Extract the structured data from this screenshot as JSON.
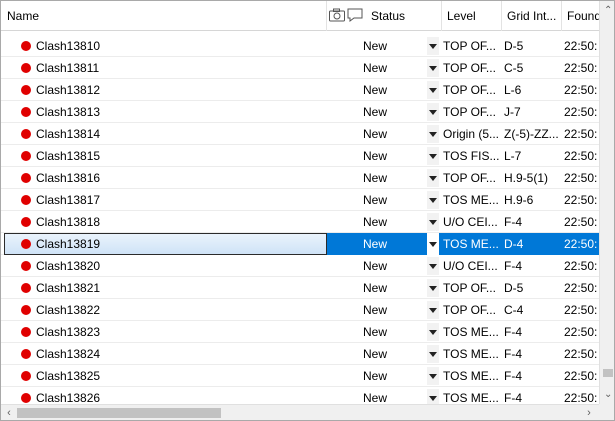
{
  "header": {
    "name": "Name",
    "status": "Status",
    "level": "Level",
    "grid": "Grid Int...",
    "found": "Found"
  },
  "icons": {
    "camera": "camera-icon",
    "comment": "comment-icon"
  },
  "colors": {
    "status_dot": "#e00000",
    "selection": "#0078d7"
  },
  "rows": [
    {
      "name": "Clash13810",
      "status": "New",
      "level": "TOP OF...",
      "grid": "D-5",
      "found": "22:50:"
    },
    {
      "name": "Clash13811",
      "status": "New",
      "level": "TOP OF...",
      "grid": "C-5",
      "found": "22:50:"
    },
    {
      "name": "Clash13812",
      "status": "New",
      "level": "TOP OF...",
      "grid": "L-6",
      "found": "22:50:"
    },
    {
      "name": "Clash13813",
      "status": "New",
      "level": "TOP OF...",
      "grid": "J-7",
      "found": "22:50:"
    },
    {
      "name": "Clash13814",
      "status": "New",
      "level": "Origin (5...",
      "grid": "Z(-5)-ZZ...",
      "found": "22:50:"
    },
    {
      "name": "Clash13815",
      "status": "New",
      "level": "TOS FIS...",
      "grid": "L-7",
      "found": "22:50:"
    },
    {
      "name": "Clash13816",
      "status": "New",
      "level": "TOP OF...",
      "grid": "H.9-5(1)",
      "found": "22:50:"
    },
    {
      "name": "Clash13817",
      "status": "New",
      "level": "TOS ME...",
      "grid": "H.9-6",
      "found": "22:50:"
    },
    {
      "name": "Clash13818",
      "status": "New",
      "level": "U/O CEI...",
      "grid": "F-4",
      "found": "22:50:"
    },
    {
      "name": "Clash13819",
      "status": "New",
      "level": "TOS ME...",
      "grid": "D-4",
      "found": "22:50:",
      "selected": true
    },
    {
      "name": "Clash13820",
      "status": "New",
      "level": "U/O CEI...",
      "grid": "F-4",
      "found": "22:50:"
    },
    {
      "name": "Clash13821",
      "status": "New",
      "level": "TOP OF...",
      "grid": "D-5",
      "found": "22:50:"
    },
    {
      "name": "Clash13822",
      "status": "New",
      "level": "TOP OF...",
      "grid": "C-4",
      "found": "22:50:"
    },
    {
      "name": "Clash13823",
      "status": "New",
      "level": "TOS ME...",
      "grid": "F-4",
      "found": "22:50:"
    },
    {
      "name": "Clash13824",
      "status": "New",
      "level": "TOS ME...",
      "grid": "F-4",
      "found": "22:50:"
    },
    {
      "name": "Clash13825",
      "status": "New",
      "level": "TOS ME...",
      "grid": "F-4",
      "found": "22:50:"
    },
    {
      "name": "Clash13826",
      "status": "New",
      "level": "TOS ME...",
      "grid": "F-4",
      "found": "22:50:"
    }
  ]
}
